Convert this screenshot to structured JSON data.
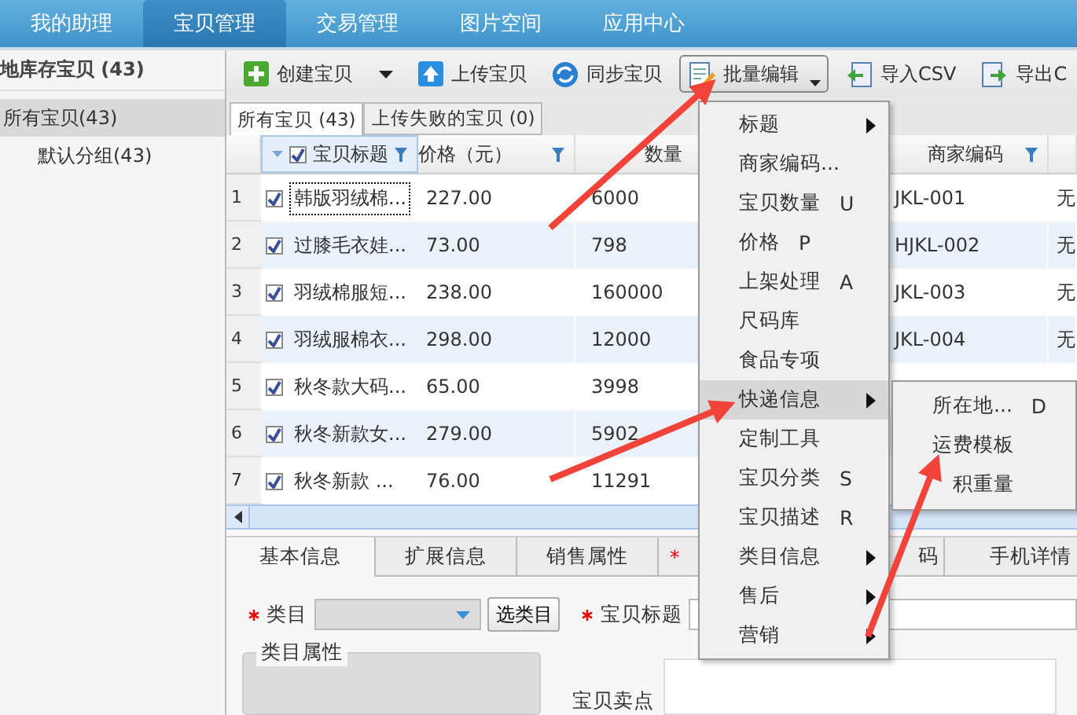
{
  "nav": [
    {
      "label": "我的助理",
      "selected": false
    },
    {
      "label": "宝贝管理",
      "selected": true
    },
    {
      "label": "交易管理",
      "selected": false
    },
    {
      "label": "图片空间",
      "selected": false
    },
    {
      "label": "应用中心",
      "selected": false
    }
  ],
  "sidebar": {
    "title": "地库存宝贝 (43)",
    "items": [
      {
        "label": "所有宝贝(43)",
        "selected": true,
        "children": [
          {
            "label": "默认分组(43)",
            "selected": false
          }
        ]
      }
    ]
  },
  "toolbar": [
    {
      "kind": "create",
      "label": "创建宝贝",
      "dropdown": true,
      "pressed": false
    },
    {
      "kind": "upload",
      "label": "上传宝贝",
      "dropdown": false,
      "pressed": false
    },
    {
      "kind": "sync",
      "label": "同步宝贝",
      "dropdown": false,
      "pressed": false
    },
    {
      "kind": "edit",
      "label": "批量编辑",
      "dropdown": true,
      "pressed": true
    },
    {
      "kind": "import",
      "label": "导入CSV",
      "dropdown": false,
      "pressed": false
    },
    {
      "kind": "export",
      "label": "导出C",
      "dropdown": false,
      "pressed": false
    }
  ],
  "list_tabs": [
    {
      "label": "所有宝贝 (43)",
      "selected": true
    },
    {
      "label": "上传失败的宝贝 (0)",
      "selected": false
    }
  ],
  "table": {
    "all_checked": true,
    "columns": [
      {
        "label": "宝贝标题"
      },
      {
        "label": "价格（元）"
      },
      {
        "label": "数量"
      },
      {
        "label": "商家编码"
      }
    ],
    "rows": [
      {
        "index": "1",
        "checked": true,
        "title": "韩版羽绒棉...",
        "price": "227.00",
        "quantity": "6000",
        "code": "JKL-001",
        "column_6": "无",
        "focused": true
      },
      {
        "index": "2",
        "checked": true,
        "title": "过膝毛衣娃...",
        "price": "73.00",
        "quantity": "798",
        "code": "HJKL-002",
        "column_6": "无",
        "focused": false
      },
      {
        "index": "3",
        "checked": true,
        "title": "羽绒棉服短...",
        "price": "238.00",
        "quantity": "160000",
        "code": "JKL-003",
        "column_6": "无",
        "focused": false
      },
      {
        "index": "4",
        "checked": true,
        "title": "羽绒服棉衣...",
        "price": "298.00",
        "quantity": "12000",
        "code": "JKL-004",
        "column_6": "无",
        "focused": false
      },
      {
        "index": "5",
        "checked": true,
        "title": "秋冬款大码...",
        "price": "65.00",
        "quantity": "3998",
        "focused": false
      },
      {
        "index": "6",
        "checked": true,
        "title": "秋冬新款女...",
        "price": "279.00",
        "quantity": "5902",
        "focused": false
      },
      {
        "index": "7",
        "checked": true,
        "title": "秋冬新款 ...",
        "price": "76.00",
        "quantity": "11291",
        "focused": false
      }
    ]
  },
  "detail_tabs": [
    {
      "label": "基本信息",
      "selected": true
    },
    {
      "label": "扩展信息",
      "selected": false
    },
    {
      "label": "销售属性",
      "selected": false
    },
    {
      "label": "*",
      "selected": false,
      "kind": "required"
    },
    {
      "label": "码",
      "selected": false,
      "kind": "cut"
    },
    {
      "label": "手机详情",
      "selected": false
    }
  ],
  "form": {
    "category_label": "类目",
    "category_required": true,
    "category_button": "选类目",
    "title_label": "宝贝标题",
    "title_required": true,
    "attributes_legend": "类目属性",
    "selling_points_label": "宝贝卖点"
  },
  "menu": {
    "items": [
      {
        "label": "标题",
        "submenu": true,
        "highlighted": false
      },
      {
        "label": "商家编码...",
        "submenu": false,
        "highlighted": false
      },
      {
        "label": "宝贝数量",
        "shortcut": "U",
        "submenu": false,
        "highlighted": false
      },
      {
        "label": "价格",
        "shortcut": "P",
        "submenu": false,
        "highlighted": false
      },
      {
        "label": "上架处理",
        "shortcut": "A",
        "submenu": false,
        "highlighted": false
      },
      {
        "label": "尺码库",
        "submenu": false,
        "highlighted": false
      },
      {
        "label": "食品专项",
        "submenu": false,
        "highlighted": false
      },
      {
        "label": "快递信息",
        "submenu": true,
        "highlighted": true
      },
      {
        "label": "定制工具",
        "submenu": false,
        "highlighted": false
      },
      {
        "label": "宝贝分类",
        "shortcut": "S",
        "submenu": false,
        "highlighted": false
      },
      {
        "label": "宝贝描述",
        "shortcut": "R",
        "submenu": false,
        "highlighted": false
      },
      {
        "label": "类目信息",
        "submenu": true,
        "highlighted": false
      },
      {
        "label": "售后",
        "submenu": true,
        "highlighted": false
      },
      {
        "label": "营销",
        "submenu": true,
        "highlighted": false
      }
    ],
    "submenu": [
      {
        "label": "所在地...",
        "shortcut": "D",
        "covered": false
      },
      {
        "label": "运费模板",
        "covered": false
      },
      {
        "label": "积重量",
        "covered": true
      }
    ]
  },
  "annotations": [
    {
      "kind": "arrow"
    },
    {
      "kind": "arrow"
    },
    {
      "kind": "arrow"
    }
  ]
}
